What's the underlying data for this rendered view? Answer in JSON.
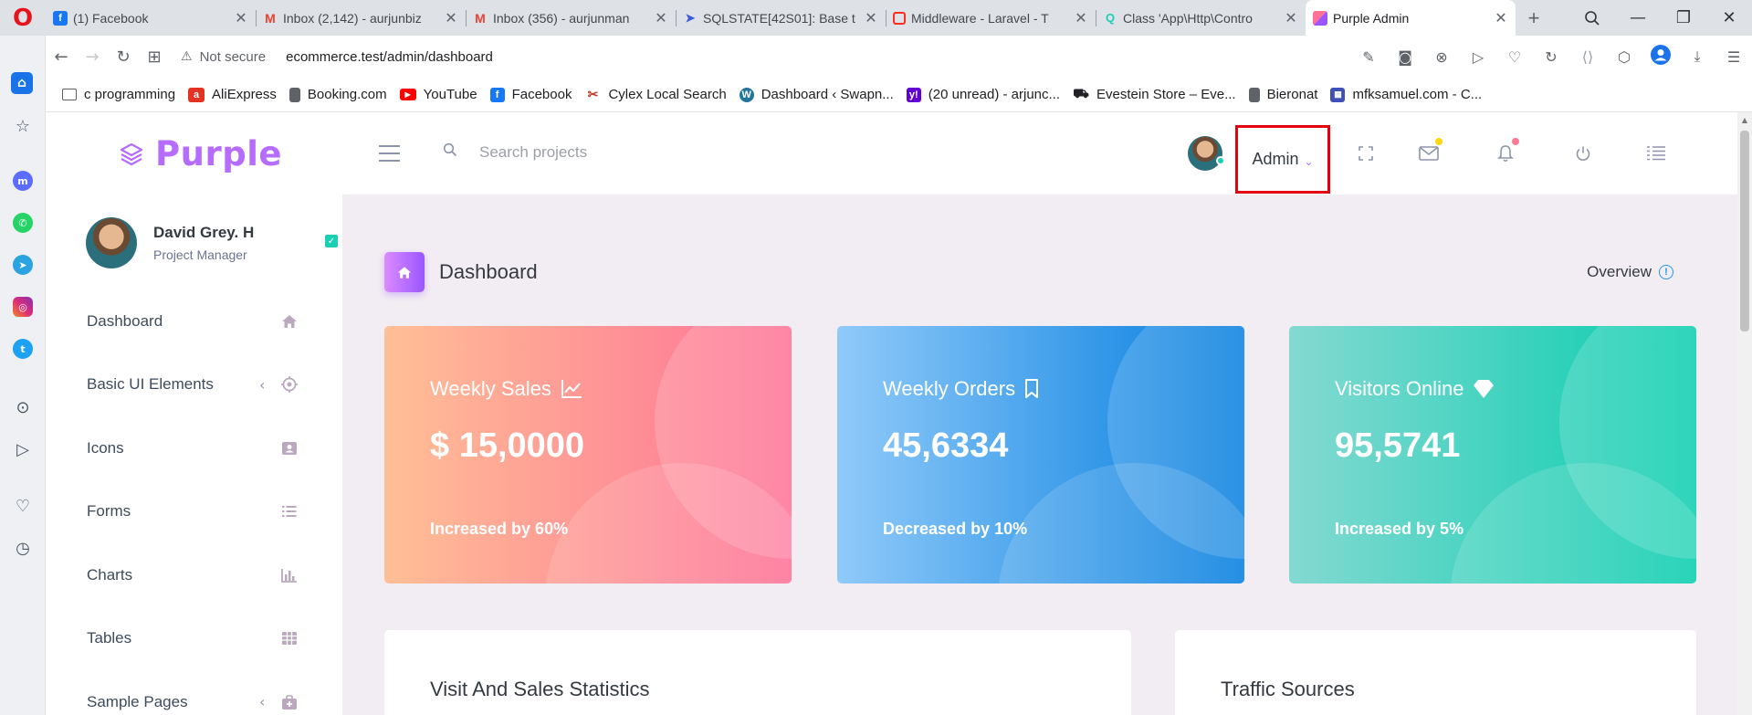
{
  "browser": {
    "tabs": [
      {
        "title": "(1) Facebook",
        "icon": "facebook-icon",
        "color": "#1877f2"
      },
      {
        "title": "Inbox (2,142) - aurjunbiz",
        "icon": "gmail-icon",
        "color": "#ea4335"
      },
      {
        "title": "Inbox (356) - aurjunman",
        "icon": "gmail-icon",
        "color": "#ea4335"
      },
      {
        "title": "SQLSTATE[42S01]: Base t",
        "icon": "paper-plane-icon",
        "color": "#3b5bdb"
      },
      {
        "title": "Middleware - Laravel - T",
        "icon": "laravel-icon",
        "color": "#ff2d20"
      },
      {
        "title": "Class 'App\\Http\\Contro",
        "icon": "laracasts-icon",
        "color": "#1bcfb4"
      },
      {
        "title": "Purple Admin",
        "icon": "purple-admin-icon",
        "color": "#b66dff"
      }
    ],
    "active_tab_index": 6,
    "security": "Not secure",
    "url": "ecommerce.test/admin/dashboard",
    "bookmarks": [
      {
        "label": "c programming",
        "icon": "folder-icon",
        "color": "#5f6368"
      },
      {
        "label": "AliExpress",
        "icon": "aliexpress-icon",
        "color": "#e43225"
      },
      {
        "label": "Booking.com",
        "icon": "file-icon",
        "color": "#5f6368"
      },
      {
        "label": "YouTube",
        "icon": "youtube-icon",
        "color": "#ff0000"
      },
      {
        "label": "Facebook",
        "icon": "facebook-icon",
        "color": "#1877f2"
      },
      {
        "label": "Cylex Local Search",
        "icon": "cylex-icon",
        "color": "#c0392b"
      },
      {
        "label": "Dashboard ‹ Swapn...",
        "icon": "wordpress-icon",
        "color": "#21759b"
      },
      {
        "label": "(20 unread) - arjunc...",
        "icon": "yahoo-icon",
        "color": "#6001d2"
      },
      {
        "label": "Evestein Store – Eve...",
        "icon": "car-icon",
        "color": "#202124"
      },
      {
        "label": "Bieronat",
        "icon": "file-icon",
        "color": "#5f6368"
      },
      {
        "label": "mfksamuel.com - C...",
        "icon": "calendar-icon",
        "color": "#3f51b5"
      }
    ]
  },
  "app": {
    "brand": "Purple",
    "profile": {
      "name": "David Grey. H",
      "role": "Project Manager"
    },
    "menu": [
      {
        "label": "Dashboard",
        "icon": "home-icon",
        "has_arrow": false
      },
      {
        "label": "Basic UI Elements",
        "icon": "crosshairs-icon",
        "has_arrow": true
      },
      {
        "label": "Icons",
        "icon": "contacts-icon",
        "has_arrow": false
      },
      {
        "label": "Forms",
        "icon": "format-list-icon",
        "has_arrow": false
      },
      {
        "label": "Charts",
        "icon": "chart-bar-icon",
        "has_arrow": false
      },
      {
        "label": "Tables",
        "icon": "table-icon",
        "has_arrow": false
      },
      {
        "label": "Sample Pages",
        "icon": "medical-bag-icon",
        "has_arrow": true
      }
    ],
    "navbar": {
      "search_placeholder": "Search projects",
      "user_label": "Admin",
      "mail_badge_color": "#fed713",
      "bell_badge_color": "#fe7c96"
    },
    "page": {
      "title": "Dashboard",
      "overview_label": "Overview"
    },
    "cards": [
      {
        "title": "Weekly Sales",
        "icon": "chart-line-icon",
        "value": "$ 15,0000",
        "note": "Increased by 60%"
      },
      {
        "title": "Weekly Orders",
        "icon": "bookmark-icon",
        "value": "45,6334",
        "note": "Decreased by 10%"
      },
      {
        "title": "Visitors Online",
        "icon": "diamond-icon",
        "value": "95,5741",
        "note": "Increased by 5%"
      }
    ],
    "panels": [
      {
        "title": "Visit And Sales Statistics"
      },
      {
        "title": "Traffic Sources"
      }
    ],
    "colors": {
      "brand": "#b66dff",
      "highlight_box": "#e3000f",
      "content_bg": "#f2edf3"
    }
  }
}
